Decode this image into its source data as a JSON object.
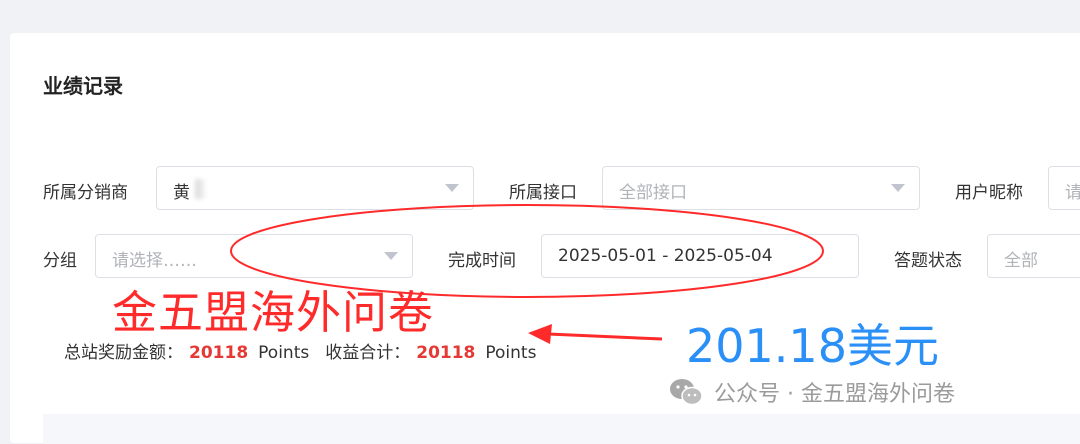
{
  "page": {
    "title": "业绩记录"
  },
  "filters": {
    "distributor": {
      "label": "所属分销商",
      "value": "黄"
    },
    "interface": {
      "label": "所属接口",
      "placeholder": "全部接口"
    },
    "nickname": {
      "label": "用户昵称",
      "placeholder": "请"
    },
    "group": {
      "label": "分组",
      "placeholder": "请选择……"
    },
    "completion_time": {
      "label": "完成时间",
      "value": "2025-05-01 - 2025-05-04"
    },
    "answer_status": {
      "label": "答题状态",
      "placeholder": "全部"
    }
  },
  "summary": {
    "reward_label": "总站奖励金额：",
    "reward_value": "20118",
    "reward_unit": "Points",
    "income_label": "收益合计：",
    "income_value": "20118",
    "income_unit": "Points"
  },
  "annotations": {
    "red_text": "金五盟海外问卷",
    "blue_text": "201.18美元",
    "color_red": "#ff2a2a",
    "color_blue": "#2a8ff7"
  },
  "watermark": {
    "text": "公众号 · 金五盟海外问卷",
    "icon": "wechat-icon"
  }
}
